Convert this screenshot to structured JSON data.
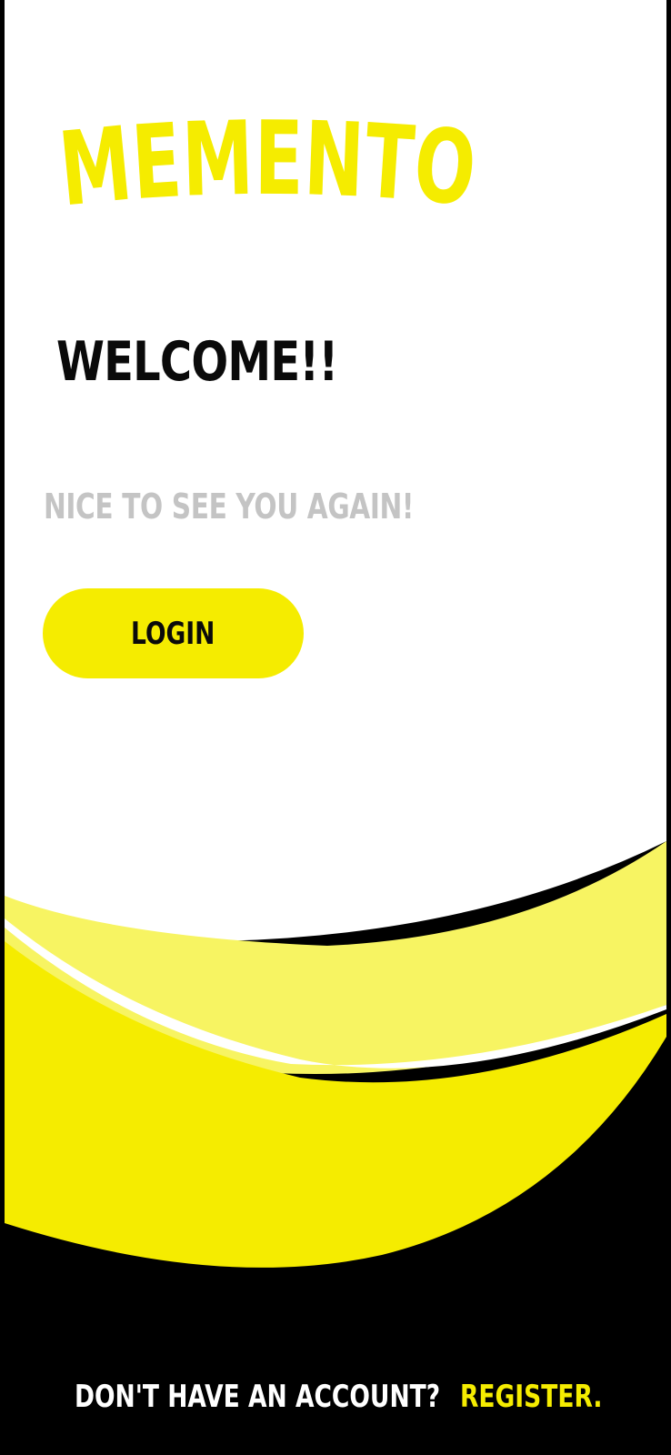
{
  "app": {
    "logo_text": "MEMENTO"
  },
  "welcome": {
    "title": "WELCOME!!",
    "subtitle": "NICE TO SEE YOU AGAIN!"
  },
  "actions": {
    "login_label": "LOGIN"
  },
  "footer": {
    "prompt": "DON'T HAVE AN ACCOUNT?",
    "register_label": "REGISTER."
  },
  "colors": {
    "accent_yellow": "#f5ec00",
    "light_yellow": "#f7f462",
    "background_white": "#ffffff",
    "background_black": "#000000",
    "title_text": "#0a0a0a",
    "subtitle_text": "#c4c4c4"
  }
}
